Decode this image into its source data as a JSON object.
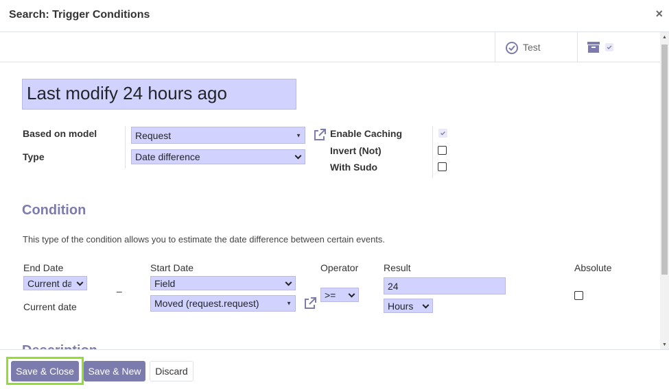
{
  "dialog": {
    "title": "Search: Trigger Conditions",
    "close": "×"
  },
  "smart_buttons": {
    "test_label": "Test"
  },
  "form": {
    "name": "Last modify 24 hours ago",
    "based_on_model_label": "Based on model",
    "based_on_model_value": "Request",
    "type_label": "Type",
    "type_value": "Date difference",
    "enable_caching_label": "Enable Caching",
    "enable_caching_checked": true,
    "invert_label": "Invert (Not)",
    "invert_checked": false,
    "with_sudo_label": "With Sudo",
    "with_sudo_checked": false
  },
  "condition": {
    "title": "Condition",
    "help": "This type of the condition allows you to estimate the date difference between certain events.",
    "end_date_label": "End Date",
    "end_date_value": "Current date",
    "end_date_text": "Current date",
    "dash": "–",
    "start_date_label": "Start Date",
    "start_date_type": "Field",
    "start_date_field": "Moved (request.request)",
    "operator_label": "Operator",
    "operator_value": ">=",
    "result_label": "Result",
    "result_value": "24",
    "result_unit": "Hours",
    "absolute_label": "Absolute",
    "absolute_checked": false
  },
  "next_section": {
    "title": "Description"
  },
  "footer": {
    "save_close": "Save & Close",
    "save_new": "Save & New",
    "discard": "Discard"
  },
  "colors": {
    "accent": "#7c7bad",
    "field_bg": "#d2d2ff",
    "highlight": "#8fe02d"
  }
}
